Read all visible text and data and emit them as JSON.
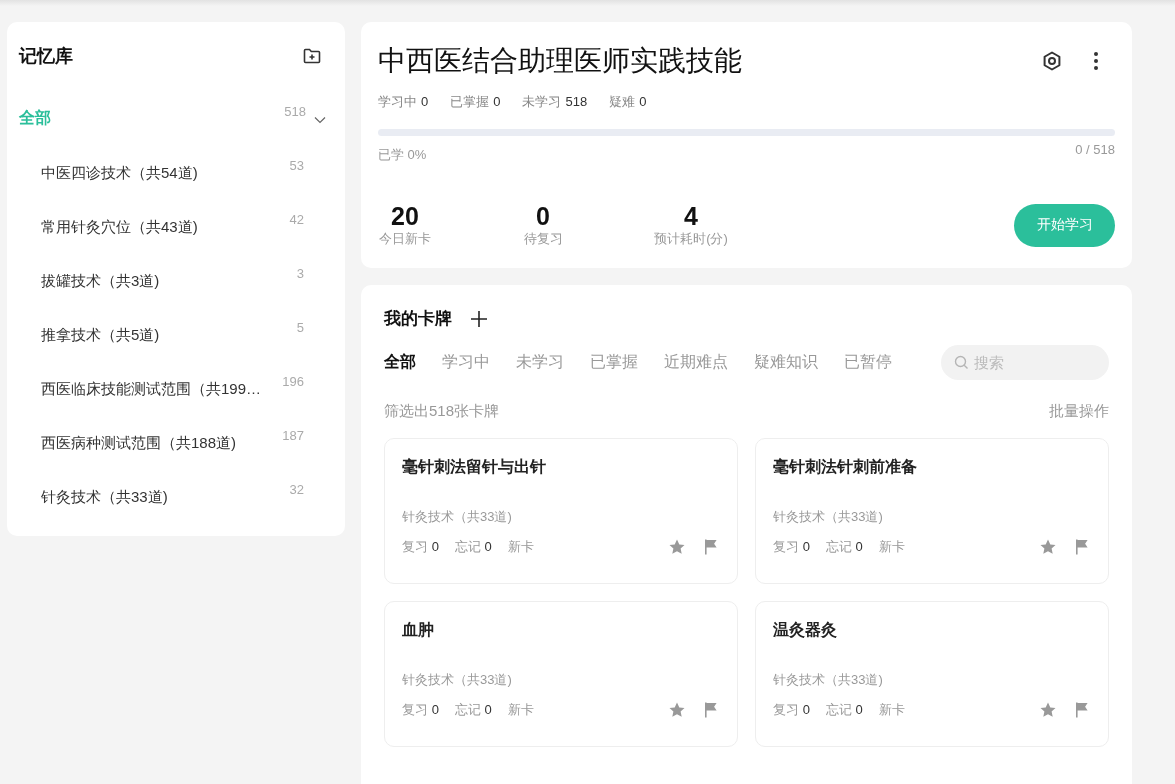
{
  "sidebar": {
    "title": "记忆库",
    "root": {
      "label": "全部",
      "count": "518",
      "selected": true,
      "expanded": true,
      "children": [
        {
          "label": "中医四诊技术（共54道)",
          "count": "53",
          "selected": false
        },
        {
          "label": "常用针灸穴位（共43道)",
          "count": "42",
          "selected": false
        },
        {
          "label": "拔罐技术（共3道)",
          "count": "3",
          "selected": false
        },
        {
          "label": "推拿技术（共5道)",
          "count": "5",
          "selected": false
        },
        {
          "label": "西医临床技能测试范围（共199…",
          "count": "196",
          "selected": false
        },
        {
          "label": "西医病种测试范围（共188道)",
          "count": "187",
          "selected": false
        },
        {
          "label": "针灸技术（共33道)",
          "count": "32",
          "selected": false
        }
      ]
    }
  },
  "deck": {
    "title": "中西医结合助理医师实践技能",
    "stats": [
      {
        "label": "学习中",
        "value": "0"
      },
      {
        "label": "已掌握",
        "value": "0"
      },
      {
        "label": "未学习",
        "value": "518"
      },
      {
        "label": "疑难",
        "value": "0"
      }
    ],
    "progress": {
      "level": 0,
      "caption": "已学 0%",
      "reading": "0 / 518"
    },
    "figures": [
      {
        "value": "20",
        "label": "今日新卡"
      },
      {
        "value": "0",
        "label": "待复习"
      },
      {
        "value": "4",
        "label": "预计耗时(分)"
      }
    ],
    "start_button": "开始学习"
  },
  "cards_panel": {
    "title": "我的卡牌",
    "tabs": [
      {
        "label": "全部",
        "selected": true
      },
      {
        "label": "学习中",
        "selected": false
      },
      {
        "label": "未学习",
        "selected": false
      },
      {
        "label": "已掌握",
        "selected": false
      },
      {
        "label": "近期难点",
        "selected": false
      },
      {
        "label": "疑难知识",
        "selected": false
      },
      {
        "label": "已暂停",
        "selected": false
      }
    ],
    "search": {
      "placeholder": "搜索"
    },
    "filter_summary": "筛选出518张卡牌",
    "bulk_action": "批量操作",
    "cards": [
      {
        "title": "毫针刺法留针与出针",
        "deck": "针灸技术（共33道)",
        "review_label": "复习",
        "review": "0",
        "forget_label": "忘记",
        "forget": "0",
        "status": "新卡",
        "starred": false,
        "flagged": false
      },
      {
        "title": "毫针刺法针刺前准备",
        "deck": "针灸技术（共33道)",
        "review_label": "复习",
        "review": "0",
        "forget_label": "忘记",
        "forget": "0",
        "status": "新卡",
        "starred": false,
        "flagged": false
      },
      {
        "title": "血肿",
        "deck": "针灸技术（共33道)",
        "review_label": "复习",
        "review": "0",
        "forget_label": "忘记",
        "forget": "0",
        "status": "新卡",
        "starred": false,
        "flagged": false
      },
      {
        "title": "温灸器灸",
        "deck": "针灸技术（共33道)",
        "review_label": "复习",
        "review": "0",
        "forget_label": "忘记",
        "forget": "0",
        "status": "新卡",
        "starred": false,
        "flagged": false
      }
    ]
  }
}
